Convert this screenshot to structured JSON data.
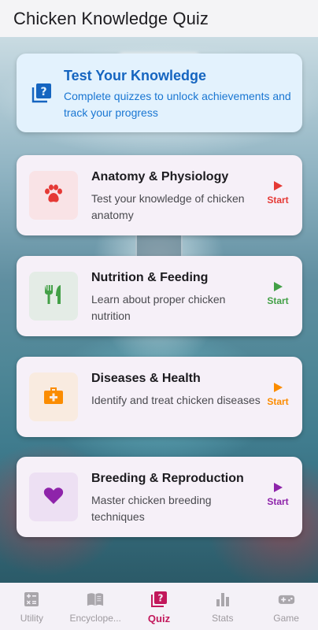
{
  "app_bar": {
    "title": "Chicken Knowledge Quiz"
  },
  "banner": {
    "title": "Test Your Knowledge",
    "subtitle": "Complete quizzes to unlock achievements and track your progress",
    "icon": "quiz-icon",
    "accent": "#1565c0"
  },
  "quizzes": [
    {
      "title": "Anatomy & Physiology",
      "description": "Test your knowledge of chicken anatomy",
      "icon": "paw-icon",
      "color": "#e53935",
      "tile_bg": "#f9e3e6",
      "start_label": "Start"
    },
    {
      "title": "Nutrition & Feeding",
      "description": "Learn about proper chicken nutrition",
      "icon": "utensils-icon",
      "color": "#43a047",
      "tile_bg": "#e4ece6",
      "start_label": "Start"
    },
    {
      "title": "Diseases & Health",
      "description": "Identify and treat chicken diseases",
      "icon": "medical-kit-icon",
      "color": "#fb8c00",
      "tile_bg": "#f9ebe0",
      "start_label": "Start"
    },
    {
      "title": "Breeding & Reproduction",
      "description": "Master chicken breeding techniques",
      "icon": "heart-icon",
      "color": "#8e24aa",
      "tile_bg": "#ede0f3",
      "start_label": "Start"
    }
  ],
  "bottom_nav": {
    "items": [
      {
        "label": "Utility",
        "icon": "calculator-icon",
        "active": false
      },
      {
        "label": "Encyclope...",
        "icon": "book-icon",
        "active": false
      },
      {
        "label": "Quiz",
        "icon": "quiz-icon",
        "active": true
      },
      {
        "label": "Stats",
        "icon": "bar-chart-icon",
        "active": false
      },
      {
        "label": "Game",
        "icon": "gamepad-icon",
        "active": false
      }
    ],
    "active_color": "#c2185b",
    "inactive_color": "#9e9a9f"
  }
}
